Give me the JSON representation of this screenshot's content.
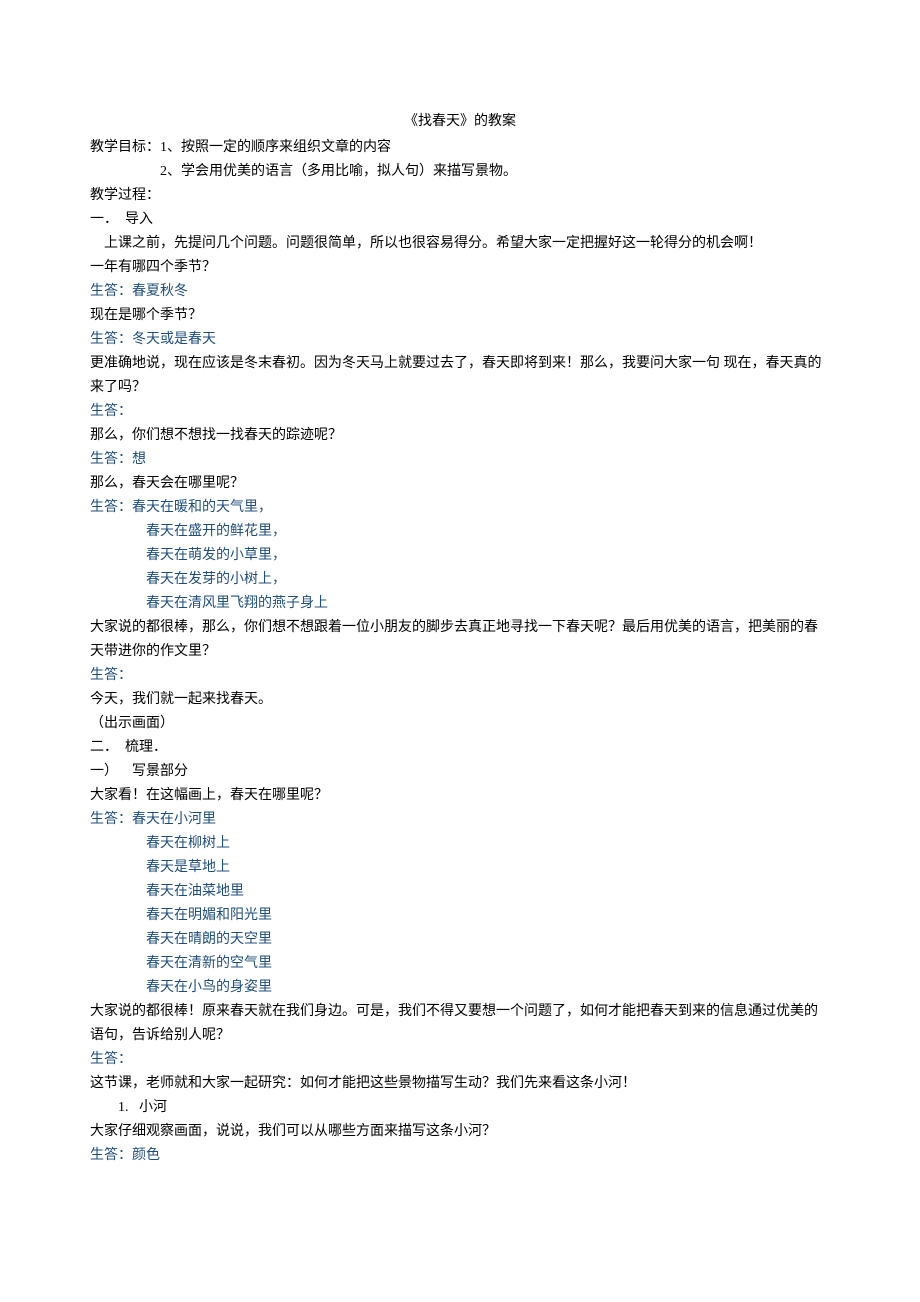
{
  "title": "《找春天》的教案",
  "lines": [
    {
      "text": "教学目标：1、按照一定的顺序来组织文章的内容",
      "cls": ""
    },
    {
      "text": "2、学会用优美的语言（多用比喻，拟人句）来描写景物。",
      "cls": "indent3"
    },
    {
      "text": "教学过程：",
      "cls": ""
    },
    {
      "text": "一．  导入",
      "cls": ""
    },
    {
      "text": "    上课之前，先提问几个问题。问题很简单，所以也很容易得分。希望大家一定把握好这一轮得分的机会啊！",
      "cls": ""
    },
    {
      "text": "一年有哪四个季节？",
      "cls": ""
    },
    {
      "text": "生答：春夏秋冬",
      "cls": "blue"
    },
    {
      "text": "现在是哪个季节？",
      "cls": ""
    },
    {
      "text": "生答：冬天或是春天",
      "cls": "blue"
    },
    {
      "text": "更准确地说，现在应该是冬末春初。因为冬天马上就要过去了，春天即将到来！那么，我要问大家一句 现在，春天真的来了吗？",
      "cls": ""
    },
    {
      "text": "生答：",
      "cls": "blue"
    },
    {
      "text": "那么，你们想不想找一找春天的踪迹呢？",
      "cls": ""
    },
    {
      "text": "生答：想",
      "cls": "blue"
    },
    {
      "text": "那么，春天会在哪里呢？",
      "cls": ""
    },
    {
      "text": "生答：春天在暖和的天气里，",
      "cls": "blue"
    },
    {
      "text": "春天在盛开的鲜花里，",
      "cls": "blue indent2"
    },
    {
      "text": "春天在萌发的小草里，",
      "cls": "blue indent2"
    },
    {
      "text": "春天在发芽的小树上，",
      "cls": "blue indent2"
    },
    {
      "text": "春天在清风里飞翔的燕子身上",
      "cls": "blue indent2"
    },
    {
      "text": "大家说的都很棒，那么，你们想不想跟着一位小朋友的脚步去真正地寻找一下春天呢？最后用优美的语言，把美丽的春天带进你的作文里？",
      "cls": ""
    },
    {
      "text": "生答：",
      "cls": "blue"
    },
    {
      "text": "今天，我们就一起来找春天。",
      "cls": ""
    },
    {
      "text": "（出示画面）",
      "cls": ""
    },
    {
      "text": "二．  梳理．",
      "cls": ""
    },
    {
      "text": "一）    写景部分",
      "cls": ""
    },
    {
      "text": "大家看！在这幅画上，春天在哪里呢？",
      "cls": ""
    },
    {
      "text": "生答：春天在小河里",
      "cls": "blue"
    },
    {
      "text": "春天在柳树上",
      "cls": "blue indent2"
    },
    {
      "text": "春天是草地上",
      "cls": "blue indent2"
    },
    {
      "text": "春天在油菜地里",
      "cls": "blue indent2"
    },
    {
      "text": "春天在明媚和阳光里",
      "cls": "blue indent2"
    },
    {
      "text": "春天在晴朗的天空里",
      "cls": "blue indent2"
    },
    {
      "text": "春天在清新的空气里",
      "cls": "blue indent2"
    },
    {
      "text": "春天在小鸟的身姿里",
      "cls": "blue indent2"
    },
    {
      "text": "大家说的都很棒！原来春天就在我们身边。可是，我们不得又要想一个问题了，如何才能把春天到来的信息通过优美的语句，告诉给别人呢？",
      "cls": ""
    },
    {
      "text": "生答：",
      "cls": "blue"
    },
    {
      "text": "这节课，老师就和大家一起研究：如何才能把这些景物描写生动？我们先来看这条小河！",
      "cls": ""
    },
    {
      "text": "1.   小河",
      "cls": "indent1"
    },
    {
      "text": "大家仔细观察画面，说说，我们可以从哪些方面来描写这条小河？",
      "cls": ""
    },
    {
      "text": "生答：颜色",
      "cls": "blue"
    }
  ]
}
